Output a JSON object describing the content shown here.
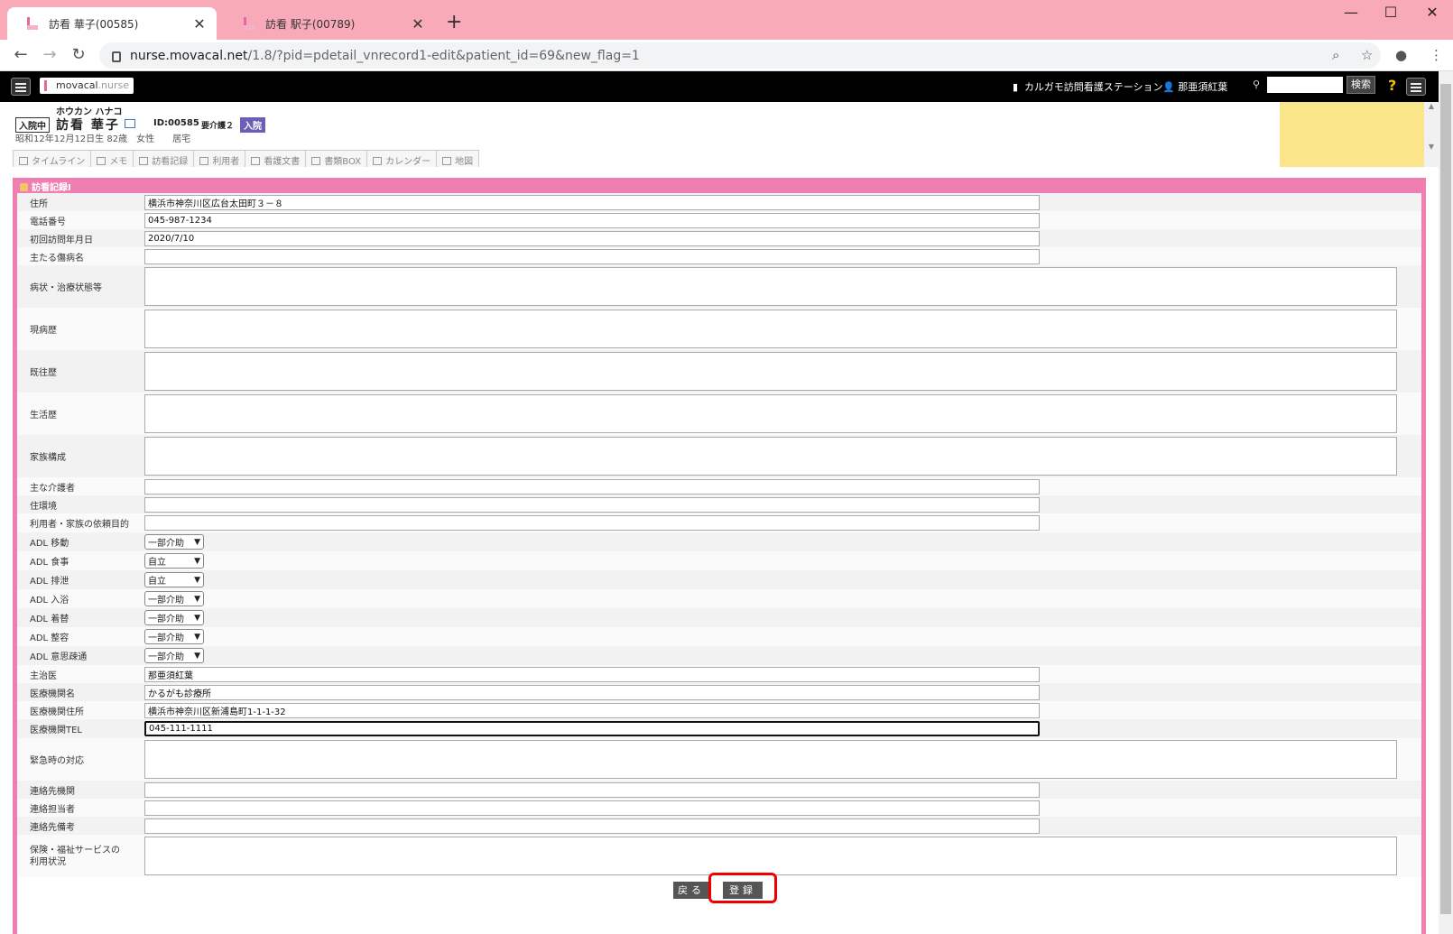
{
  "browser": {
    "tabs": [
      {
        "title": "訪看 華子(00585)",
        "active": true
      },
      {
        "title": "訪看 駅子(00789)",
        "active": false
      }
    ],
    "url_host": "nurse.movacal.net",
    "url_path": "/1.8/?pid=pdetail_vnrecord1-edit&patient_id=69&new_flag=1"
  },
  "app": {
    "logo_main": "movacal",
    "logo_sub": ".nurse",
    "station": "カルガモ訪問看護ステーション",
    "user": "那亜須紅葉",
    "search_label": "検索",
    "help": "?"
  },
  "patient": {
    "kana": "ホウカン ハナコ",
    "status": "入院中",
    "name": "訪看 華子",
    "id": "ID:00585",
    "care_level": "要介護２",
    "badge": "入院",
    "info": "昭和12年12月12日生 82歳　女性　　居宅"
  },
  "subtabs": [
    "タイムライン",
    "メモ",
    "訪看記録",
    "利用者",
    "看護文書",
    "書類BOX",
    "カレンダー",
    "地図"
  ],
  "form": {
    "title": "訪看記録Ⅰ",
    "fields": {
      "address": {
        "label": "住所",
        "value": "横浜市神奈川区広台太田町３－８"
      },
      "phone": {
        "label": "電話番号",
        "value": "045-987-1234"
      },
      "first_visit": {
        "label": "初回訪問年月日",
        "value": "2020/7/10"
      },
      "main_disease": {
        "label": "主たる傷病名",
        "value": ""
      },
      "condition": {
        "label": "病状・治療状態等",
        "value": ""
      },
      "present_illness": {
        "label": "現病歴",
        "value": ""
      },
      "past_history": {
        "label": "既往歴",
        "value": ""
      },
      "life_history": {
        "label": "生活歴",
        "value": ""
      },
      "family": {
        "label": "家族構成",
        "value": ""
      },
      "caregiver": {
        "label": "主な介護者",
        "value": ""
      },
      "environment": {
        "label": "住環境",
        "value": ""
      },
      "purpose": {
        "label": "利用者・家族の依頼目的",
        "value": ""
      },
      "adl_move": {
        "label": "ADL 移動",
        "value": "一部介助"
      },
      "adl_eat": {
        "label": "ADL 食事",
        "value": "自立"
      },
      "adl_excrete": {
        "label": "ADL 排泄",
        "value": "自立"
      },
      "adl_bath": {
        "label": "ADL 入浴",
        "value": "一部介助"
      },
      "adl_dress": {
        "label": "ADL 着替",
        "value": "一部介助"
      },
      "adl_groom": {
        "label": "ADL 整容",
        "value": "一部介助"
      },
      "adl_comm": {
        "label": "ADL 意思疎通",
        "value": "一部介助"
      },
      "doctor": {
        "label": "主治医",
        "value": "那亜須紅葉"
      },
      "hospital": {
        "label": "医療機関名",
        "value": "かるがも診療所"
      },
      "hospital_addr": {
        "label": "医療機関住所",
        "value": "横浜市神奈川区新浦島町1-1-1-32"
      },
      "hospital_tel": {
        "label": "医療機関TEL",
        "value": "045-111-1111"
      },
      "emergency": {
        "label": "緊急時の対応",
        "value": ""
      },
      "contact_org": {
        "label": "連絡先機関",
        "value": ""
      },
      "contact_person": {
        "label": "連絡担当者",
        "value": ""
      },
      "contact_note": {
        "label": "連絡先備考",
        "value": ""
      },
      "services": {
        "label": "保険・福祉サービスの利用状況",
        "value": ""
      }
    },
    "back_label": "戻る",
    "register_label": "登録"
  }
}
